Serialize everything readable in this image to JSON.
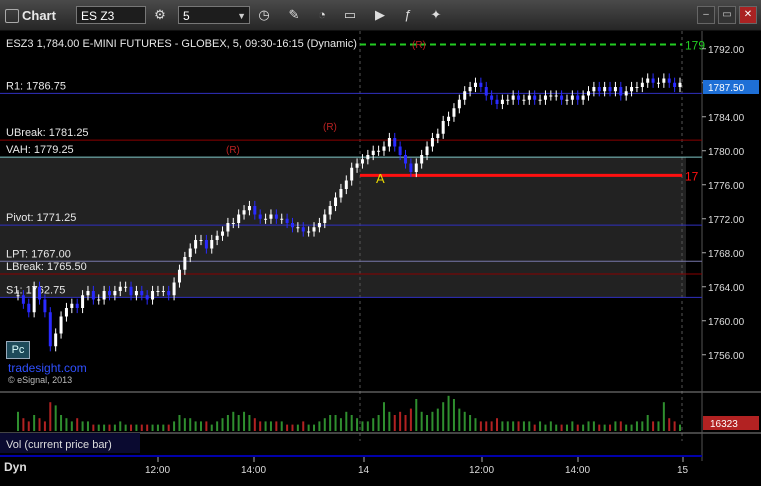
{
  "window": {
    "title": "Chart",
    "symbol": "ES Z3",
    "interval": "5",
    "controls": [
      "close-button",
      "minimize-button",
      "restore-button"
    ]
  },
  "chart_header": "ESZ3 1,784.00 E-MINI FUTURES - GLOBEX, 5, 09:30-16:15 (Dynamic)",
  "watermark": "tradesight.com",
  "copyright": "© eSignal, 2013",
  "pc_button": "Pc",
  "volume_label": "Vol (current price bar)",
  "dyn_label": "Dyn",
  "colors": {
    "up_candle": "#ffffff",
    "down_candle": "#2a2aff",
    "volume_up": "#2f8f2f",
    "volume_down": "#b22222",
    "level_line": "#3030c0",
    "price_tag": "#1e6fd6",
    "red_level": "#ff1010",
    "green_level": "#22cc22"
  },
  "chart_data": {
    "type": "candlestick",
    "y_ticks": [
      "1792.00",
      "1788.00",
      "1784.00",
      "1780.00",
      "1776.00",
      "1772.00",
      "1768.00",
      "1764.00",
      "1760.00",
      "1756.00"
    ],
    "ylim": [
      1753.5,
      1793.5
    ],
    "x_ticks": [
      "12:00",
      "14:00",
      "14",
      "12:00",
      "14:00",
      "15"
    ],
    "levels": [
      {
        "label": "R1: 1786.75",
        "value": 1786.75,
        "color": "#3030c0"
      },
      {
        "label": "UBreak: 1781.25",
        "value": 1781.25,
        "color": "#8b0000"
      },
      {
        "label": "VAH: 1779.25",
        "value": 1779.25,
        "color": "#7fc8c8"
      },
      {
        "label": "Pivot: 1771.25",
        "value": 1771.25,
        "color": "#3030c0"
      },
      {
        "label": "LPT: 1767.00",
        "value": 1767.0,
        "color": "#7777aa"
      },
      {
        "label": "LBreak: 1765.50",
        "value": 1765.5,
        "color": "#8b0000"
      },
      {
        "label": "S1: 1762.75",
        "value": 1762.75,
        "color": "#3030c0"
      }
    ],
    "current_price": "1787.50",
    "current_value": 1787.5,
    "red_level_label": "17",
    "green_level_label": "179",
    "annotations": [
      "(R)",
      "(R)",
      "(R)",
      "A"
    ],
    "volume_value": "16323",
    "closes": [
      1763.0,
      1762.0,
      1761.0,
      1764.0,
      1762.5,
      1761.0,
      1757.0,
      1758.5,
      1760.5,
      1761.5,
      1762.0,
      1761.5,
      1763.0,
      1763.5,
      1762.5,
      1762.5,
      1763.5,
      1763.0,
      1763.5,
      1764.0,
      1764.0,
      1763.0,
      1763.5,
      1763.0,
      1762.5,
      1763.5,
      1763.5,
      1763.5,
      1763.0,
      1764.5,
      1766.0,
      1767.5,
      1768.5,
      1769.5,
      1769.5,
      1768.5,
      1769.5,
      1770.0,
      1770.5,
      1771.5,
      1771.5,
      1772.5,
      1773.0,
      1773.5,
      1772.5,
      1772.0,
      1772.0,
      1772.5,
      1772.0,
      1772.0,
      1771.5,
      1771.0,
      1771.0,
      1770.5,
      1770.5,
      1771.0,
      1771.5,
      1772.5,
      1773.5,
      1774.5,
      1775.5,
      1776.5,
      1778.0,
      1778.5,
      1779.0,
      1779.5,
      1780.0,
      1780.0,
      1780.5,
      1781.5,
      1780.5,
      1779.5,
      1778.5,
      1777.5,
      1778.5,
      1779.5,
      1780.5,
      1781.5,
      1782.0,
      1783.5,
      1784.0,
      1785.0,
      1786.0,
      1787.0,
      1787.5,
      1788.0,
      1787.5,
      1786.5,
      1786.0,
      1785.5,
      1786.0,
      1786.0,
      1786.5,
      1786.0,
      1786.0,
      1786.5,
      1786.0,
      1786.0,
      1786.5,
      1786.5,
      1786.5,
      1786.0,
      1786.0,
      1786.5,
      1786.0,
      1786.5,
      1787.0,
      1787.5,
      1787.0,
      1787.5,
      1787.0,
      1787.5,
      1786.5,
      1787.0,
      1787.5,
      1787.5,
      1788.0,
      1788.5,
      1788.0,
      1788.0,
      1788.5,
      1788.0,
      1787.5,
      1788.0
    ],
    "volumes": [
      6,
      4,
      3,
      5,
      4,
      3,
      9,
      8,
      5,
      4,
      3,
      4,
      3,
      3,
      2,
      2,
      2,
      2,
      2,
      3,
      2,
      2,
      2,
      2,
      2,
      2,
      2,
      2,
      2,
      3,
      5,
      4,
      4,
      3,
      3,
      3,
      2,
      3,
      4,
      5,
      6,
      5,
      6,
      5,
      4,
      3,
      3,
      3,
      3,
      3,
      2,
      2,
      2,
      3,
      2,
      2,
      3,
      4,
      5,
      5,
      4,
      6,
      5,
      4,
      3,
      3,
      4,
      5,
      9,
      6,
      5,
      6,
      5,
      7,
      10,
      6,
      5,
      6,
      7,
      9,
      11,
      10,
      7,
      6,
      5,
      4,
      3,
      3,
      3,
      4,
      3,
      3,
      3,
      3,
      3,
      3,
      2,
      3,
      2,
      3,
      2,
      2,
      2,
      3,
      2,
      2,
      3,
      3,
      2,
      2,
      2,
      3,
      3,
      2,
      2,
      3,
      3,
      5,
      3,
      3,
      9,
      4,
      3,
      2
    ]
  }
}
